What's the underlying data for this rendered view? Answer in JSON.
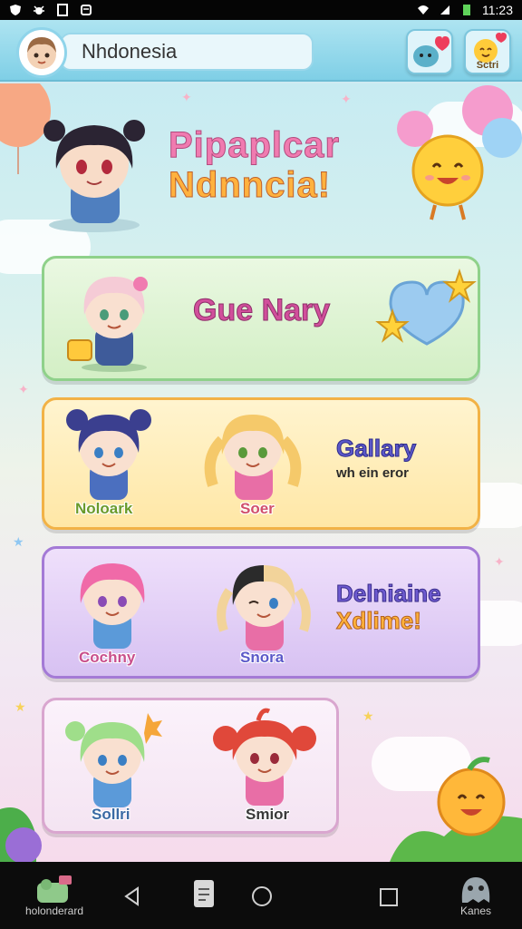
{
  "status_bar": {
    "time": "11:23"
  },
  "header": {
    "search_text": "Nhdonesia",
    "right_button_label": "Sctri"
  },
  "hero": {
    "title_line1": "Pipaplcar",
    "title_line2": "Ndnncia!"
  },
  "cards": {
    "story": {
      "title": "Gue Nary"
    },
    "gallery": {
      "title": "Gallary",
      "subtitle": "wh ein eror",
      "char1": "Noloark",
      "char2": "Soer"
    },
    "delusions": {
      "title_line1": "Delniaine",
      "title_line2": "Xdlime!",
      "char1": "Cochny",
      "char2": "Snora"
    },
    "extra": {
      "char1": "Sollri",
      "char2": "Smior"
    }
  },
  "nav": {
    "left_label": "holonderard",
    "right_label": "Kanes"
  },
  "icons": [
    "shield-icon",
    "bug-icon",
    "box-icon",
    "note-icon",
    "wifi-icon",
    "signal-icon",
    "battery-icon",
    "back-icon",
    "home-icon",
    "recents-icon",
    "file-icon",
    "heart-icon",
    "star-icon"
  ],
  "colors": {
    "accent_cyan": "#7fcfe6",
    "card_green": "#8fd18a",
    "card_yellow": "#f2b246",
    "card_purple": "#a47ad6",
    "card_pink": "#d9a6cf"
  }
}
